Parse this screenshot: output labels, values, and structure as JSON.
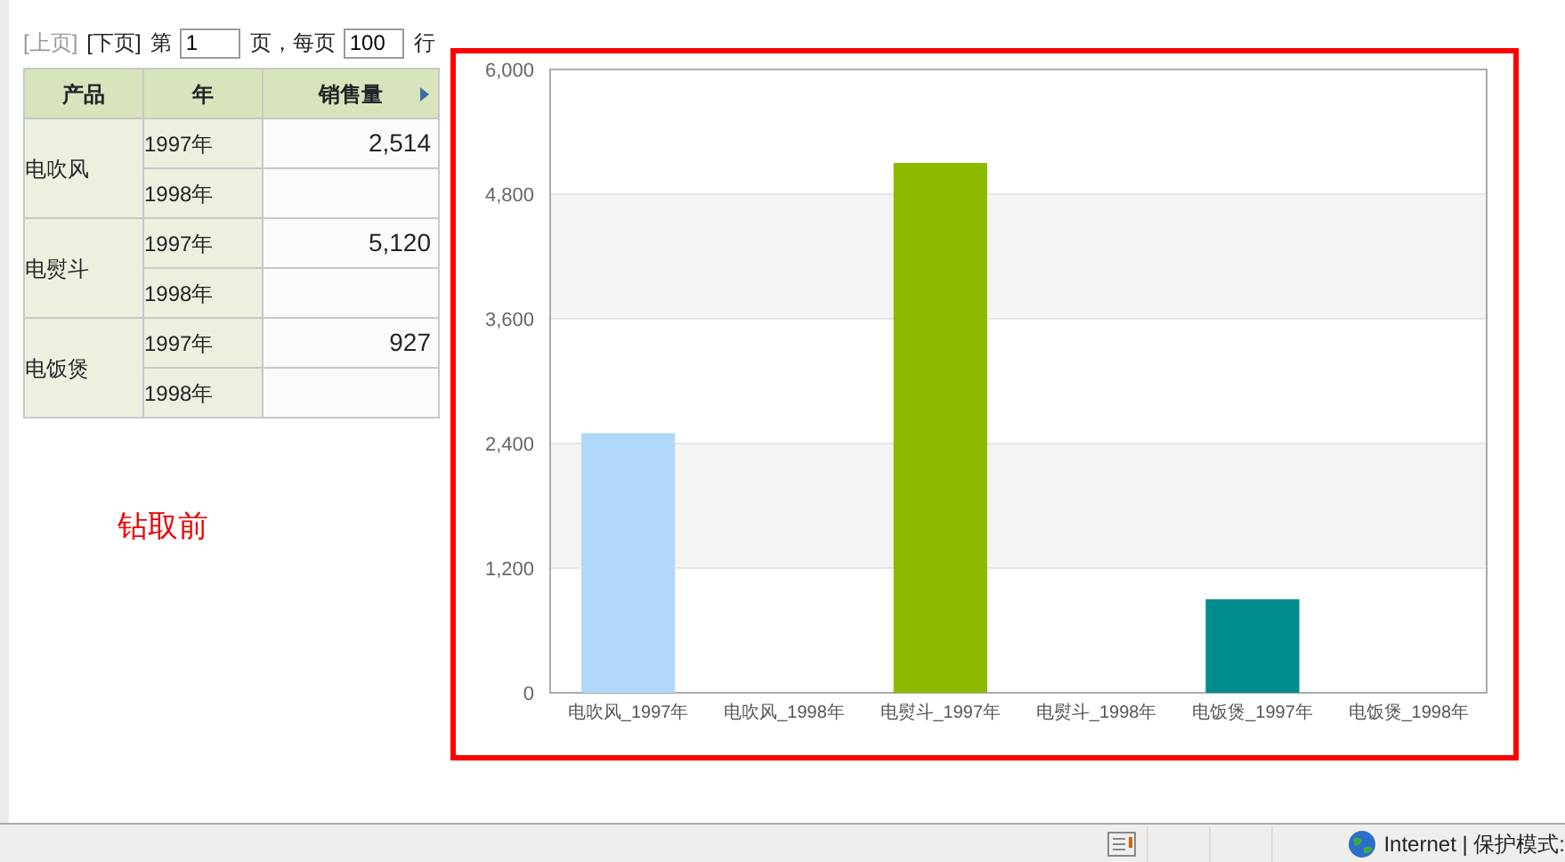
{
  "pager": {
    "prev": "[上页]",
    "prev_disabled": true,
    "next": "[下页]",
    "page_prefix": "第",
    "page": "1",
    "page_suffix": "页，每页",
    "per_page": "100",
    "per_page_suffix": "行"
  },
  "table": {
    "columns": [
      "产品",
      "年",
      "销售量"
    ],
    "groups": [
      {
        "product": "电吹风",
        "rows": [
          {
            "year": "1997年",
            "value": "2,514"
          },
          {
            "year": "1998年",
            "value": ""
          }
        ]
      },
      {
        "product": "电熨斗",
        "rows": [
          {
            "year": "1997年",
            "value": "5,120"
          },
          {
            "year": "1998年",
            "value": ""
          }
        ]
      },
      {
        "product": "电饭煲",
        "rows": [
          {
            "year": "1997年",
            "value": "927"
          },
          {
            "year": "1998年",
            "value": ""
          }
        ]
      }
    ]
  },
  "note": "钻取前",
  "chart": {
    "chart_data": {
      "type": "bar",
      "grid": true,
      "categories": [
        "电吹风_1997年",
        "电吹风_1998年",
        "电熨斗_1997年",
        "电熨斗_1998年",
        "电饭煲_1997年",
        "电饭煲_1998年"
      ],
      "series": [
        {
          "color": "#b0d8f8",
          "values": [
            2500,
            null,
            null,
            null,
            null,
            null
          ]
        },
        {
          "color": "#8cba00",
          "values": [
            null,
            null,
            5100,
            null,
            null,
            null
          ]
        },
        {
          "color": "#008c8c",
          "values": [
            null,
            null,
            null,
            null,
            900,
            null
          ]
        }
      ],
      "ylim": [
        0,
        6000
      ],
      "yticks": [
        {
          "value": 0,
          "label": "0"
        },
        {
          "value": 1200,
          "label": "1,200"
        },
        {
          "value": 2400,
          "label": "2,400"
        },
        {
          "value": 3600,
          "label": "3,600"
        },
        {
          "value": 4800,
          "label": "4,800"
        },
        {
          "value": 6000,
          "label": "6,000"
        }
      ]
    }
  },
  "status_bar": {
    "zone": "Internet | 保护模式:"
  }
}
